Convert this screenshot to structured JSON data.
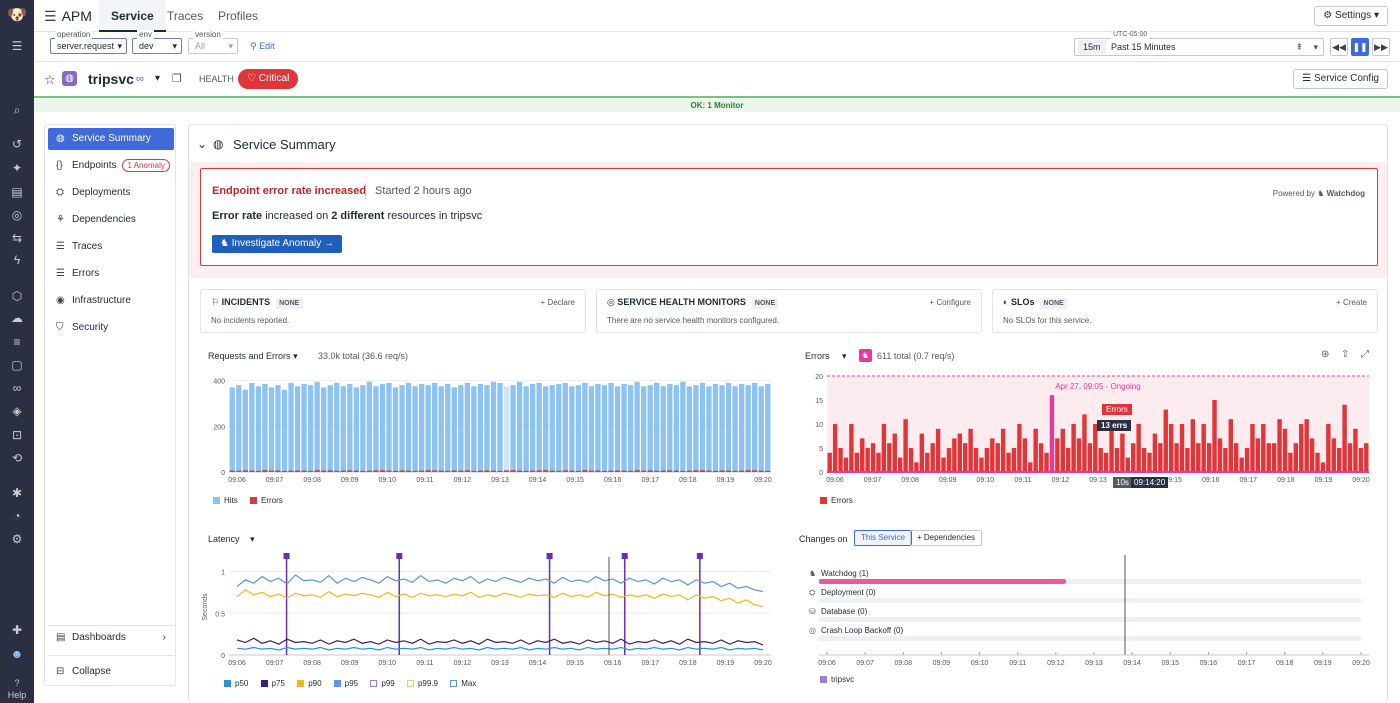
{
  "nav": {
    "help": "Help"
  },
  "topbar": {
    "app": "APM",
    "tabs": [
      "Service",
      "Traces",
      "Profiles"
    ],
    "settings": "Settings"
  },
  "filters": {
    "operation": {
      "caption": "operation",
      "value": "server.request"
    },
    "env": {
      "caption": "env",
      "value": "dev"
    },
    "version": {
      "caption": "version",
      "value": "All"
    },
    "edit": "Edit"
  },
  "time": {
    "timezone": "UTC-05:00",
    "preset": "15m",
    "label": "Past 15 Minutes"
  },
  "service": {
    "name": "tripsvc",
    "health_label": "HEALTH",
    "status": "Critical",
    "config": "Service Config",
    "monitor_banner": "OK: 1 Monitor"
  },
  "sidebar": {
    "items": [
      {
        "label": "Service Summary",
        "icon": "globe-icon"
      },
      {
        "label": "Endpoints",
        "icon": "braces-icon",
        "badge": "1 Anomaly"
      },
      {
        "label": "Deployments",
        "icon": "deploy-icon"
      },
      {
        "label": "Dependencies",
        "icon": "dependencies-icon"
      },
      {
        "label": "Traces",
        "icon": "traces-icon"
      },
      {
        "label": "Errors",
        "icon": "errors-icon"
      },
      {
        "label": "Infrastructure",
        "icon": "infra-icon"
      },
      {
        "label": "Security",
        "icon": "shield-icon"
      }
    ],
    "dashboards": "Dashboards",
    "collapse": "Collapse"
  },
  "summary": {
    "title": "Service Summary",
    "anomaly": {
      "title": "Endpoint error rate increased",
      "started": "Started 2 hours ago",
      "powered_by": "Powered by",
      "watchdog": "Watchdog",
      "body_prefix": "Error rate",
      "body_mid": " increased on ",
      "body_bold": "2 different",
      "body_suffix": " resources in tripsvc",
      "button": "Investigate Anomaly"
    },
    "cards": [
      {
        "title": "INCIDENTS",
        "tag": "NONE",
        "action": "Declare",
        "desc": "No incidents reported."
      },
      {
        "title": "SERVICE HEALTH MONITORS",
        "tag": "NONE",
        "action": "Configure",
        "desc": "There are no service health monitors configured."
      },
      {
        "title": "SLOs",
        "tag": "NONE",
        "action": "Create",
        "desc": "No SLOs for this service."
      }
    ]
  },
  "widgets": {
    "requests": {
      "title": "Requests and Errors",
      "total": "33.0k total (36.6 req/s)",
      "legend": [
        "Hits",
        "Errors"
      ]
    },
    "errors": {
      "title": "Errors",
      "total": "611 total (0.7 req/s)",
      "legend": [
        "Errors"
      ],
      "annotation": "Apr 27, 09:05 - Ongoing",
      "tooltip_series": "Errors",
      "tooltip_value": "13 errs",
      "cursor_res": "10s",
      "cursor_time": "09:14:20"
    },
    "latency": {
      "title": "Latency",
      "ylabel": "Seconds",
      "legend": [
        "p50",
        "p75",
        "p90",
        "p95",
        "p99",
        "p99.9",
        "Max"
      ]
    },
    "changes": {
      "title": "Changes on",
      "toggle": [
        "This Service",
        "+ Dependencies"
      ],
      "rows": [
        "Watchdog (1)",
        "Deployment (0)",
        "Database (0)",
        "Crash Loop Backoff (0)"
      ],
      "legend": "tripsvc"
    }
  },
  "chart_data": [
    {
      "type": "bar",
      "title": "Requests and Errors",
      "categories": [
        "09:06",
        "09:07",
        "09:08",
        "09:09",
        "09:10",
        "09:11",
        "09:12",
        "09:13",
        "09:14",
        "09:15",
        "09:16",
        "09:17",
        "09:18",
        "09:19",
        "09:20"
      ],
      "ylim": [
        0,
        420
      ],
      "yticks": [
        0,
        200,
        400
      ],
      "series": [
        {
          "name": "Hits",
          "color": "#8cc3f2",
          "values": [
            370,
            380,
            360,
            390,
            375,
            385,
            370,
            380,
            360,
            390,
            375,
            385,
            380,
            395,
            370,
            380,
            390,
            375,
            385,
            370,
            380,
            395,
            375,
            385,
            390,
            370,
            380,
            390,
            375,
            385,
            380,
            390,
            375,
            385,
            370,
            380,
            390,
            375,
            385,
            380,
            395,
            390,
            375,
            380,
            395,
            375,
            385,
            390,
            375,
            380,
            385,
            390,
            375,
            380,
            390,
            375,
            385,
            380,
            390,
            375,
            385,
            380,
            395,
            375,
            380,
            390,
            375,
            385,
            380,
            395,
            375,
            380,
            390,
            375,
            385,
            380,
            390,
            375,
            385,
            380,
            390,
            375,
            385
          ]
        },
        {
          "name": "Errors",
          "color": "#e0363a",
          "values": [
            6,
            5,
            7,
            6,
            5,
            8,
            6,
            7,
            5,
            6,
            7,
            6,
            5,
            8,
            6,
            7,
            5,
            6,
            7,
            6,
            5,
            6,
            7,
            8,
            6,
            5,
            7,
            6,
            5,
            6,
            8,
            7,
            6,
            5,
            7,
            6,
            8,
            5,
            6,
            7,
            6,
            5,
            7,
            8,
            6,
            5,
            6,
            7,
            8,
            6,
            5,
            7,
            6,
            5,
            8,
            6,
            7,
            5,
            6,
            7,
            6,
            5,
            8,
            6,
            7,
            5,
            6,
            7,
            6,
            5,
            6,
            7,
            8,
            6,
            5,
            7,
            6,
            5,
            6,
            8,
            7,
            6,
            5
          ]
        }
      ]
    },
    {
      "type": "bar",
      "title": "Errors",
      "categories": [
        "09:06",
        "09:07",
        "09:08",
        "09:09",
        "09:10",
        "09:11",
        "09:12",
        "09:13",
        "09:14",
        "09:15",
        "09:16",
        "09:17",
        "09:18",
        "09:19",
        "09:20"
      ],
      "ylim": [
        0,
        20
      ],
      "yticks": [
        0,
        5,
        10,
        15,
        20
      ],
      "series": [
        {
          "name": "Errors",
          "color": "#e0363a",
          "values": [
            4,
            10,
            5,
            3,
            10,
            4,
            7,
            5,
            6,
            4,
            10,
            6,
            8,
            3,
            11,
            5,
            2,
            8,
            4,
            6,
            9,
            3,
            5,
            7,
            8,
            6,
            9,
            5,
            3,
            5,
            7,
            6,
            9,
            4,
            5,
            10,
            7,
            2,
            9,
            6,
            4,
            16,
            7,
            9,
            5,
            10,
            7,
            12,
            6,
            10,
            5,
            4,
            9,
            5,
            8,
            3,
            6,
            10,
            5,
            4,
            8,
            6,
            13,
            10,
            6,
            10,
            5,
            11,
            6,
            10,
            6,
            15,
            7,
            5,
            11,
            6,
            3,
            5,
            10,
            7,
            10,
            6,
            6,
            11,
            9,
            4,
            6,
            10,
            11,
            7,
            4,
            2,
            10,
            7,
            5,
            14,
            6,
            9,
            5,
            6
          ]
        }
      ],
      "annotation": "Apr 27, 09:05 - Ongoing",
      "threshold": 20
    },
    {
      "type": "line",
      "title": "Latency",
      "ylabel": "Seconds",
      "x": [
        "09:06",
        "09:07",
        "09:08",
        "09:09",
        "09:10",
        "09:11",
        "09:12",
        "09:13",
        "09:14",
        "09:15",
        "09:16",
        "09:17",
        "09:18",
        "09:19",
        "09:20"
      ],
      "ylim": [
        0,
        1.15
      ],
      "yticks": [
        0,
        0.5,
        1
      ],
      "series": [
        {
          "name": "p95",
          "color": "#5b95e8",
          "values": [
            0.82,
            0.9,
            0.86,
            0.94,
            0.88,
            0.92,
            0.85,
            0.96,
            0.89,
            0.9,
            0.87,
            0.95,
            0.86,
            0.92,
            0.88,
            0.93,
            0.9,
            0.86,
            0.94,
            0.89,
            0.91,
            0.87,
            0.95,
            0.88,
            0.9,
            0.86,
            0.92,
            0.89,
            0.94,
            0.86,
            0.91,
            0.88,
            0.93,
            0.9,
            0.87,
            0.92,
            0.89,
            0.91,
            0.86,
            0.93,
            0.88,
            0.9,
            0.87,
            0.94,
            0.89,
            0.91,
            0.86,
            0.92,
            0.88,
            0.9,
            0.85,
            0.92,
            0.88,
            0.9,
            0.84,
            0.9,
            0.86,
            0.88,
            0.82,
            0.86,
            0.8,
            0.82,
            0.78,
            0.76
          ]
        },
        {
          "name": "p90",
          "color": "#f0b91a",
          "values": [
            0.7,
            0.78,
            0.72,
            0.75,
            0.7,
            0.73,
            0.68,
            0.74,
            0.71,
            0.72,
            0.69,
            0.76,
            0.7,
            0.73,
            0.71,
            0.74,
            0.72,
            0.69,
            0.75,
            0.7,
            0.73,
            0.69,
            0.74,
            0.71,
            0.72,
            0.7,
            0.73,
            0.71,
            0.75,
            0.69,
            0.72,
            0.7,
            0.74,
            0.72,
            0.69,
            0.73,
            0.71,
            0.72,
            0.69,
            0.74,
            0.7,
            0.72,
            0.69,
            0.75,
            0.71,
            0.73,
            0.69,
            0.72,
            0.7,
            0.72,
            0.68,
            0.73,
            0.7,
            0.72,
            0.66,
            0.72,
            0.68,
            0.7,
            0.65,
            0.68,
            0.62,
            0.66,
            0.6,
            0.58
          ]
        },
        {
          "name": "p75",
          "color": "#3a1f78",
          "values": [
            0.18,
            0.15,
            0.2,
            0.14,
            0.17,
            0.13,
            0.19,
            0.15,
            0.16,
            0.14,
            0.18,
            0.13,
            0.17,
            0.15,
            0.19,
            0.14,
            0.16,
            0.13,
            0.18,
            0.15,
            0.17,
            0.14,
            0.19,
            0.13,
            0.16,
            0.15,
            0.18,
            0.14,
            0.17,
            0.13,
            0.19,
            0.15,
            0.16,
            0.14,
            0.18,
            0.13,
            0.17,
            0.15,
            0.19,
            0.14,
            0.16,
            0.13,
            0.18,
            0.15,
            0.17,
            0.14,
            0.19,
            0.13,
            0.16,
            0.15,
            0.18,
            0.14,
            0.17,
            0.13,
            0.19,
            0.15,
            0.16,
            0.14,
            0.18,
            0.13,
            0.17,
            0.15,
            0.16,
            0.12
          ]
        },
        {
          "name": "p50",
          "color": "#2b8fd9",
          "values": [
            0.08,
            0.07,
            0.09,
            0.07,
            0.08,
            0.06,
            0.09,
            0.07,
            0.08,
            0.07,
            0.09,
            0.06,
            0.08,
            0.07,
            0.09,
            0.07,
            0.08,
            0.06,
            0.09,
            0.07,
            0.08,
            0.07,
            0.09,
            0.06,
            0.08,
            0.07,
            0.09,
            0.07,
            0.08,
            0.06,
            0.09,
            0.07,
            0.08,
            0.07,
            0.09,
            0.06,
            0.08,
            0.07,
            0.09,
            0.07,
            0.08,
            0.06,
            0.09,
            0.07,
            0.08,
            0.07,
            0.09,
            0.06,
            0.08,
            0.07,
            0.09,
            0.07,
            0.08,
            0.06,
            0.09,
            0.07,
            0.08,
            0.07,
            0.09,
            0.06,
            0.08,
            0.07,
            0.08,
            0.06
          ]
        }
      ],
      "markers": [
        "09:07",
        "09:10",
        "09:14",
        "09:16",
        "09:18"
      ]
    },
    {
      "type": "bar",
      "title": "Changes on",
      "categories": [
        "09:06",
        "09:07",
        "09:08",
        "09:09",
        "09:10",
        "09:11",
        "09:12",
        "09:13",
        "09:14",
        "09:15",
        "09:16",
        "09:17",
        "09:18",
        "09:19",
        "09:20"
      ],
      "series": [
        {
          "name": "Watchdog (1)",
          "color": "#f0569e",
          "start": "09:06",
          "end": "09:12"
        }
      ]
    }
  ]
}
